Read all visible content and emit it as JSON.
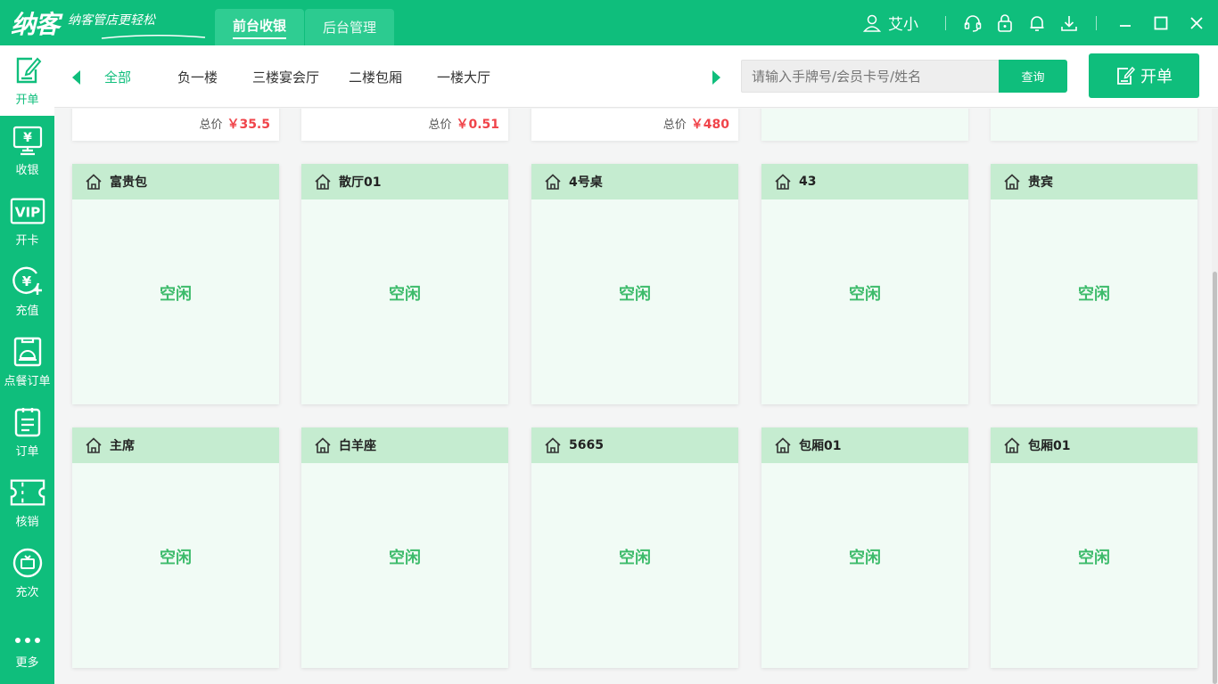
{
  "app": {
    "logo": "纳客",
    "slogan": "纳客管店更轻松",
    "tabs": [
      {
        "label": "前台收银",
        "active": true
      },
      {
        "label": "后台管理",
        "active": false
      }
    ],
    "user": "艾小"
  },
  "sidebar": {
    "items": [
      {
        "label": "开单",
        "icon": "open-order-icon",
        "active": true
      },
      {
        "label": "收银",
        "icon": "cashier-icon",
        "active": false
      },
      {
        "label": "开卡",
        "icon": "vip-card-icon",
        "active": false
      },
      {
        "label": "充值",
        "icon": "recharge-icon",
        "active": false
      },
      {
        "label": "点餐订单",
        "icon": "meal-order-icon",
        "active": false
      },
      {
        "label": "订单",
        "icon": "order-icon",
        "active": false
      },
      {
        "label": "核销",
        "icon": "verify-icon",
        "active": false
      },
      {
        "label": "充次",
        "icon": "recharge-times-icon",
        "active": false
      },
      {
        "label": "更多",
        "icon": "more-icon",
        "active": false
      }
    ]
  },
  "nav": {
    "categories": [
      {
        "label": "全部",
        "active": true
      },
      {
        "label": "负一楼",
        "active": false
      },
      {
        "label": "三楼宴会厅",
        "active": false
      },
      {
        "label": "二楼包厢",
        "active": false
      },
      {
        "label": "一楼大厅",
        "active": false
      }
    ],
    "search_placeholder": "请输入手牌号/会员卡号/姓名",
    "search_button": "查询",
    "open_button": "开单"
  },
  "partial_cards": [
    {
      "total_label": "总价",
      "amount": "￥35.5"
    },
    {
      "total_label": "总价",
      "amount": "￥0.51"
    },
    {
      "total_label": "总价",
      "amount": "￥480"
    },
    {
      "total_label": "",
      "amount": ""
    },
    {
      "total_label": "",
      "amount": ""
    }
  ],
  "tables": [
    {
      "name": "富贵包",
      "status": "空闲"
    },
    {
      "name": "散厅01",
      "status": "空闲"
    },
    {
      "name": "4号桌",
      "status": "空闲"
    },
    {
      "name": "43",
      "status": "空闲"
    },
    {
      "name": "贵宾",
      "status": "空闲"
    },
    {
      "name": "主席",
      "status": "空闲"
    },
    {
      "name": "白羊座",
      "status": "空闲"
    },
    {
      "name": "5665",
      "status": "空闲"
    },
    {
      "name": "包厢01",
      "status": "空闲"
    },
    {
      "name": "包厢01",
      "status": "空闲"
    }
  ],
  "colors": {
    "brand": "#0fbe7c",
    "card_header": "#c5ecd0",
    "card_body": "#f1fbf5",
    "status_text": "#3dbb6b",
    "price": "#f0444a"
  }
}
